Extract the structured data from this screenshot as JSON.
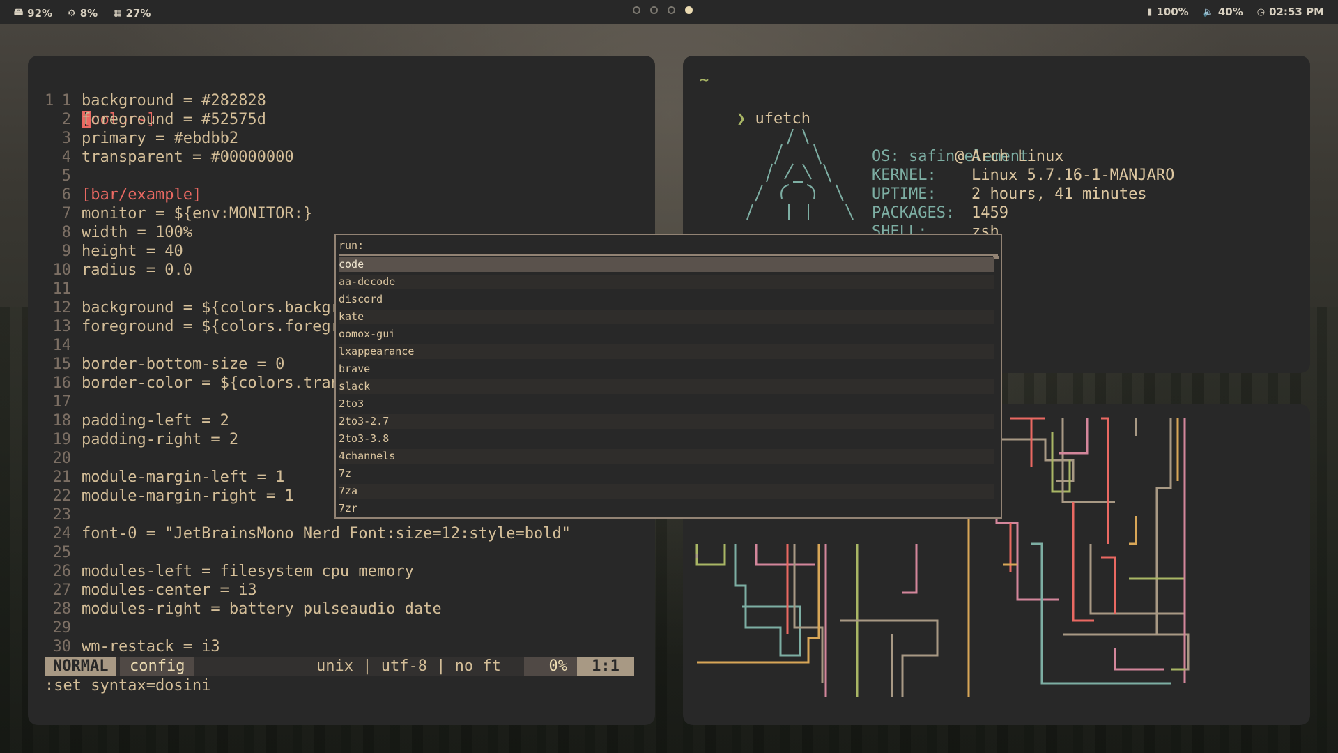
{
  "topbar": {
    "filesystem": "92%",
    "cpu": "8%",
    "memory": "27%",
    "workspaces": 4,
    "active_workspace": 4,
    "battery": "100%",
    "volume": "40%",
    "time": "02:53 PM"
  },
  "editor": {
    "first_line": {
      "num": "1",
      "text": "[colors]"
    },
    "lines": [
      {
        "num": "1",
        "text": "background = #282828"
      },
      {
        "num": "2",
        "text": "foreground = #52575d"
      },
      {
        "num": "3",
        "text": "primary = #ebdbb2"
      },
      {
        "num": "4",
        "text": "transparent = #00000000"
      },
      {
        "num": "5",
        "text": ""
      },
      {
        "num": "6",
        "text": "[bar/example]",
        "section": true
      },
      {
        "num": "7",
        "text": "monitor = ${env:MONITOR:}"
      },
      {
        "num": "8",
        "text": "width = 100%"
      },
      {
        "num": "9",
        "text": "height = 40"
      },
      {
        "num": "10",
        "text": "radius = 0.0"
      },
      {
        "num": "11",
        "text": ""
      },
      {
        "num": "12",
        "text": "background = ${colors.backgr"
      },
      {
        "num": "13",
        "text": "foreground = ${colors.foregr"
      },
      {
        "num": "14",
        "text": ""
      },
      {
        "num": "15",
        "text": "border-bottom-size = 0"
      },
      {
        "num": "16",
        "text": "border-color = ${colors.tran"
      },
      {
        "num": "17",
        "text": ""
      },
      {
        "num": "18",
        "text": "padding-left = 2"
      },
      {
        "num": "19",
        "text": "padding-right = 2"
      },
      {
        "num": "20",
        "text": ""
      },
      {
        "num": "21",
        "text": "module-margin-left = 1"
      },
      {
        "num": "22",
        "text": "module-margin-right = 1"
      },
      {
        "num": "23",
        "text": ""
      },
      {
        "num": "24",
        "text": "font-0 = \"JetBrainsMono Nerd Font:size=12:style=bold\""
      },
      {
        "num": "25",
        "text": ""
      },
      {
        "num": "26",
        "text": "modules-left = filesystem cpu memory"
      },
      {
        "num": "27",
        "text": "modules-center = i3"
      },
      {
        "num": "28",
        "text": "modules-right = battery pulseaudio date"
      },
      {
        "num": "29",
        "text": ""
      },
      {
        "num": "30",
        "text": "wm-restack = i3"
      }
    ],
    "status": {
      "mode": "NORMAL",
      "filename": "config",
      "fileinfo": "unix | utf-8 | no ft",
      "percent": "0%",
      "position": "1:1"
    },
    "command": ":set syntax=dosini"
  },
  "terminal": {
    "tilde": "~",
    "prompt_symbol": "❯",
    "command": "ufetch",
    "user": "safin",
    "at": "@",
    "host": "element",
    "info": [
      {
        "key": "OS:",
        "value": "Arch Linux"
      },
      {
        "key": "KERNEL:",
        "value": "Linux 5.7.16-1-MANJARO"
      },
      {
        "key": "UPTIME:",
        "value": "2 hours, 41 minutes"
      },
      {
        "key": "PACKAGES:",
        "value": "1459"
      },
      {
        "key": "SHELL:",
        "value": "zsh"
      }
    ]
  },
  "launcher": {
    "prompt": "run:",
    "selected_index": 0,
    "items": [
      "code",
      "aa-decode",
      "discord",
      "kate",
      "oomox-gui",
      "lxappearance",
      "brave",
      "slack",
      "2to3",
      "2to3-2.7",
      "2to3-3.8",
      "4channels",
      "7z",
      "7za",
      "7zr"
    ]
  },
  "colors": {
    "bg": "#282828",
    "fg": "#d4be98",
    "red": "#ea6962",
    "green": "#a9b665",
    "yellow": "#d8a657",
    "blue": "#7daea3",
    "purple": "#d3869b",
    "aqua": "#89b482",
    "gray": "#a89984"
  }
}
